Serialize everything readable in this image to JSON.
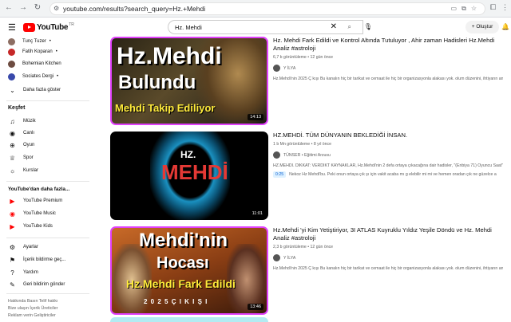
{
  "browser": {
    "url": "youtube.com/results?search_query=Hz.+Mehdi"
  },
  "header": {
    "logo_text": "YouTube",
    "logo_sup": "TR",
    "search_value": "Hz. Mehdi",
    "create_label": "+ Oluştur"
  },
  "sidebar": {
    "subs": [
      {
        "label": "Tunç Tuzer",
        "color": "#8d6e63"
      },
      {
        "label": "Fatih Koparan",
        "color": "#c62828"
      },
      {
        "label": "Bohemian Kitchen",
        "color": "#6d4c41"
      },
      {
        "label": "Sociates Dergi",
        "color": "#3949ab"
      }
    ],
    "more_label": "Daha fazla göster",
    "explore_title": "Keşfet",
    "explore": [
      {
        "label": "Müzik",
        "icon": "music-icon"
      },
      {
        "label": "Canlı",
        "icon": "live-icon"
      },
      {
        "label": "Oyun",
        "icon": "gaming-icon"
      },
      {
        "label": "Spor",
        "icon": "trophy-icon"
      },
      {
        "label": "Kurslar",
        "icon": "bulb-icon"
      }
    ],
    "more_title": "YouTube'dan daha fazla...",
    "more_items": [
      {
        "label": "YouTube Premium"
      },
      {
        "label": "YouTube Music"
      },
      {
        "label": "YouTube Kids"
      }
    ],
    "settings": [
      {
        "label": "Ayarlar",
        "icon": "gear-icon"
      },
      {
        "label": "İçerik bildirme geç...",
        "icon": "flag-icon"
      },
      {
        "label": "Yardım",
        "icon": "help-icon"
      },
      {
        "label": "Geri bildirim gönder",
        "icon": "feedback-icon"
      }
    ],
    "footer1": "Hakkında  Basın  Telif hakkı",
    "footer2": "Bize ulaşın  İçerik Üreticiler",
    "footer3": "Reklam verin  Geliştiriciler"
  },
  "results": [
    {
      "title": "Hz. Mehdi Fark Edildi ve Kontrol Altında Tutuluyor , Ahir zaman Hadisleri Hz.Mehdi Analiz #astroloji",
      "meta": "6,7 b görüntüleme • 12 gün önce",
      "channel": "Y İLYA",
      "desc": "Hz.Mehdi'nin 2025 Ç kışı Bu kanalın hiç bir tarikat ve cemaat ile hiç bir organizasyonla alakası yok. olum düzenini, ihtiyarın analizlerini...",
      "duration": "14:13",
      "thumb_line1": "Hz.Mehdi",
      "thumb_line2": "Bulundu",
      "thumb_line3": "Mehdi Takip Ediliyor"
    },
    {
      "title": "HZ.MEHDİ. TÜM DÜNYANIN BEKLEDİĞİ İNSAN.",
      "meta": "1 b Mn görüntüleme • 8 yıl önce",
      "channel": "TÜNSER • Eğitimi Arzusu",
      "desc": "HZ.MEHDİ. DİKKAT: VERDİKT KAYNAKLAR, Hz.Mehdi'nin 2 defa ortaya çıkacağına dair hadisler, \"(Enbiya 71) Oyuncu Saat\"a",
      "chapter_ts": "0:25",
      "chapter_text": "Nekoz Hz Mehdi'bu. Peki onun ortaya çık şı için vakit acaba mı g elebilir mi mi ve hemen oradan çık ne güzelce alamadını yapıyoruz...",
      "duration": "11:01",
      "thumb_line1": "HZ.",
      "thumb_line2": "MEHDİ"
    },
    {
      "title": "Hz.Mehdi 'yi Kim Yetiştiriyor, 3I ATLAS Kuyruklu Yıldız Yeşile Döndü ve Hz. Mehdi Analiz #astroloji",
      "meta": "2,3 b görüntüleme • 12 gün önce",
      "channel": "Y İLYA",
      "desc": "Hz.Mehdi'nin 2025 Ç kışı Bu kanalın hiç bir tarikat ve cemaat ile hiç bir organizasyonla alakası yok. olum düzenini, ihtiyarın analizlerini...",
      "duration": "13:46",
      "thumb_line1": "Mehdi'nin",
      "thumb_line2": "Hocası",
      "thumb_line3": "Hz.Mehdi Fark Edildi",
      "thumb_line4": "2 0 2 5  Ç I K I Ş I"
    }
  ]
}
